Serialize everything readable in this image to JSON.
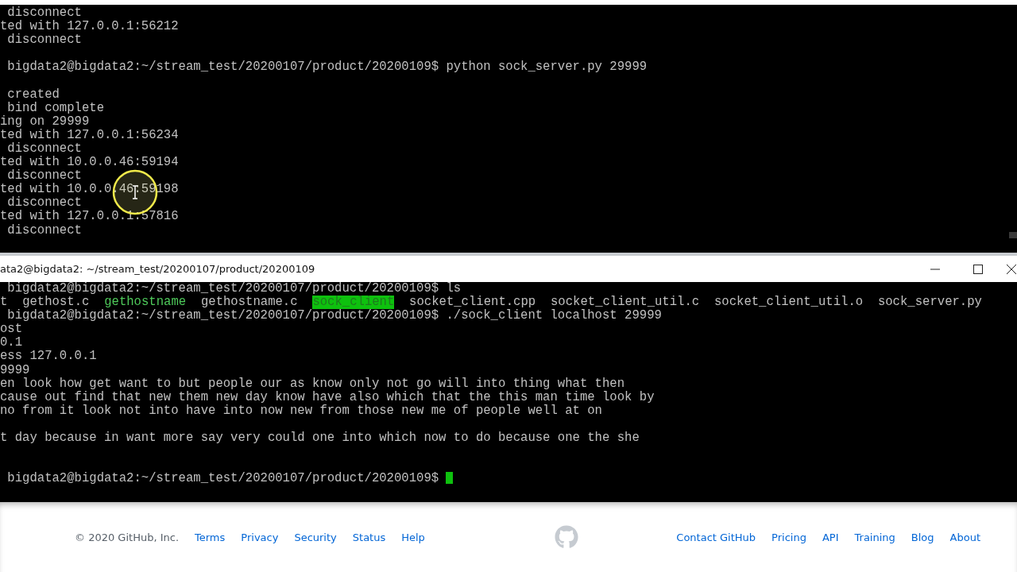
{
  "top_terminal": {
    "lines": [
      {
        "kind": "text",
        "text": " disconnect"
      },
      {
        "kind": "text",
        "text": "ted with 127.0.0.1:56212"
      },
      {
        "kind": "text",
        "text": " disconnect"
      },
      {
        "kind": "blank"
      },
      {
        "kind": "text",
        "text": " bigdata2@bigdata2:~/stream_test/20200107/product/20200109$ python sock_server.py 29999"
      },
      {
        "kind": "blank"
      },
      {
        "kind": "text",
        "text": " created"
      },
      {
        "kind": "text",
        "text": " bind complete"
      },
      {
        "kind": "text",
        "text": "ing on 29999"
      },
      {
        "kind": "text",
        "text": "ted with 127.0.0.1:56234"
      },
      {
        "kind": "text",
        "text": " disconnect"
      },
      {
        "kind": "text",
        "text": "ted with 10.0.0.46:59194"
      },
      {
        "kind": "text",
        "text": " disconnect"
      },
      {
        "kind": "text",
        "text": "ted with 10.0.0.46:59198"
      },
      {
        "kind": "text",
        "text": " disconnect"
      },
      {
        "kind": "text",
        "text": "ted with 127.0.0.1:57816"
      },
      {
        "kind": "text",
        "text": " disconnect"
      }
    ]
  },
  "bottom_window": {
    "title": "ata2@bigdata2: ~/stream_test/20200107/product/20200109",
    "lines": [
      {
        "kind": "text",
        "text": " bigdata2@bigdata2:~/stream_test/20200107/product/20200109$ ls"
      },
      {
        "kind": "listing",
        "segments": [
          {
            "text": "t",
            "kind": "file"
          },
          {
            "text": "gethost.c",
            "kind": "file"
          },
          {
            "text": "gethostname",
            "kind": "executable"
          },
          {
            "text": "gethostname.c",
            "kind": "file"
          },
          {
            "text": "sock_client",
            "kind": "highlighted"
          },
          {
            "text": "socket_client.cpp",
            "kind": "file"
          },
          {
            "text": "socket_client_util.c",
            "kind": "file"
          },
          {
            "text": "socket_client_util.o",
            "kind": "file"
          },
          {
            "text": "sock_server.py",
            "kind": "file"
          }
        ]
      },
      {
        "kind": "text",
        "text": " bigdata2@bigdata2:~/stream_test/20200107/product/20200109$ ./sock_client localhost 29999"
      },
      {
        "kind": "text",
        "text": "ost"
      },
      {
        "kind": "text",
        "text": "0.1"
      },
      {
        "kind": "text",
        "text": "ess 127.0.0.1"
      },
      {
        "kind": "text",
        "text": "9999"
      },
      {
        "kind": "text",
        "text": "en look how get want to but people our as know only not go will into thing what then"
      },
      {
        "kind": "text",
        "text": "cause out find that new them new day know have also which that the this man time look by"
      },
      {
        "kind": "text",
        "text": "no from it look not into have into now new from those new me of people well at on"
      },
      {
        "kind": "blank"
      },
      {
        "kind": "text",
        "text": "t day because in want more say very could one into which now to do because one the she"
      },
      {
        "kind": "blank"
      },
      {
        "kind": "blank"
      },
      {
        "kind": "prompt",
        "text": " bigdata2@bigdata2:~/stream_test/20200107/product/20200109$ "
      }
    ]
  },
  "footer": {
    "copyright": "© 2020 GitHub, Inc.",
    "left_links": [
      "Terms",
      "Privacy",
      "Security",
      "Status",
      "Help"
    ],
    "right_links": [
      "Contact GitHub",
      "Pricing",
      "API",
      "Training",
      "Blog",
      "About"
    ]
  }
}
